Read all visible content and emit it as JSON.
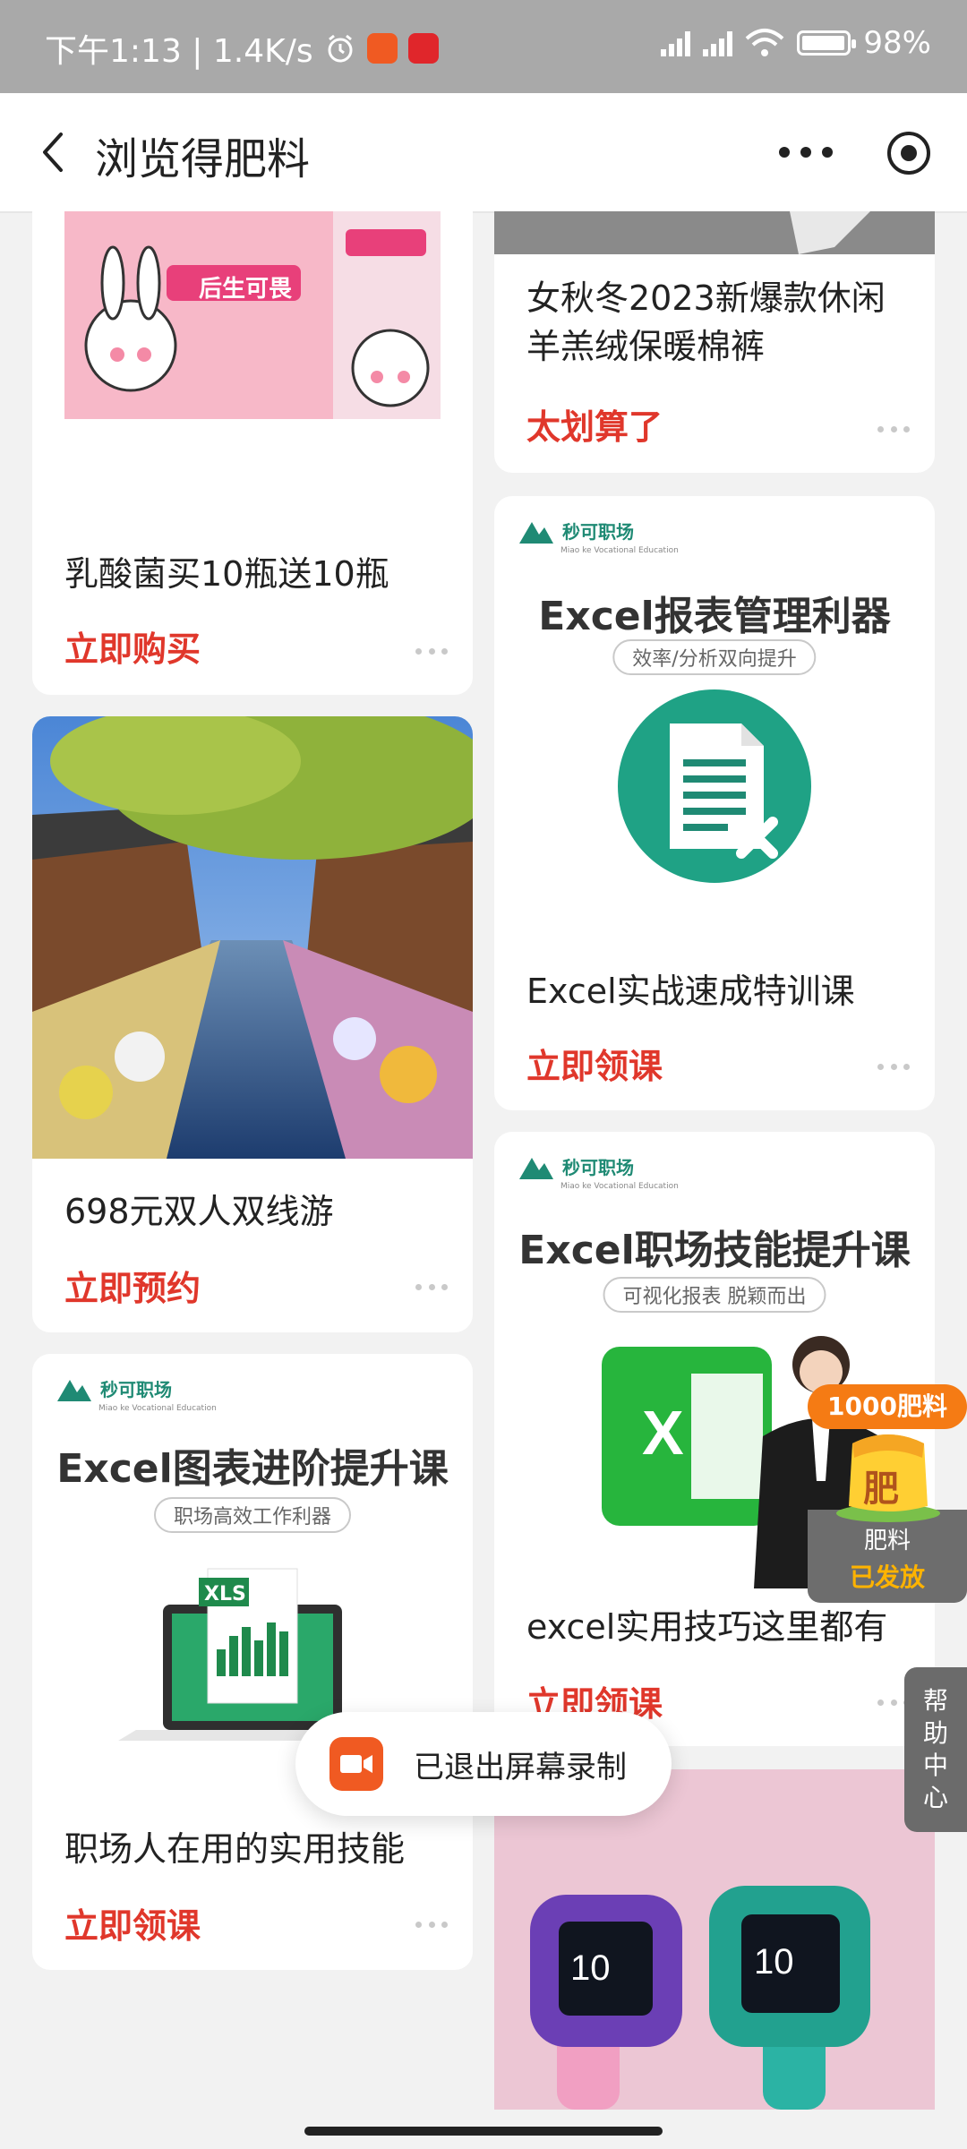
{
  "status_bar": {
    "time_speed": "下午1:13 | 1.4K/s",
    "battery": "98%",
    "battery_level": 0.98,
    "icons": [
      "alarm-icon",
      "screen-record-app-icon",
      "news-app-icon",
      "signal-hd-1-icon",
      "signal-hd-2-icon",
      "wifi-icon",
      "battery-icon"
    ]
  },
  "header": {
    "title": "浏览得肥料",
    "back_icon": "chevron-left-icon",
    "more_icon": "more-dots-icon",
    "target_icon": "target-icon"
  },
  "cards": {
    "yogurt": {
      "image_text": "后生可畏",
      "name": "乳酸菌买10瓶送10瓶",
      "cta": "立即购买"
    },
    "pants": {
      "name": "女秋冬2023新爆款休闲羊羔绒保暖棉裤",
      "cta": "太划算了"
    },
    "excel_report": {
      "brand": "秒可职场",
      "brand_sub": "Miao ke Vocational Education",
      "promo_title": "Excel报表管理利器",
      "promo_pill": "效率/分析双向提升",
      "name": "Excel实战速成特训课",
      "cta": "立即领课"
    },
    "travel": {
      "name": "698元双人双线游",
      "cta": "立即预约"
    },
    "excel_skill": {
      "brand": "秒可职场",
      "brand_sub": "Miao ke Vocational Education",
      "promo_title": "Excel职场技能提升课",
      "promo_pill": "可视化报表 脱颖而出",
      "name": "excel实用技巧这里都有",
      "cta": "立即领课"
    },
    "excel_chart": {
      "brand": "秒可职场",
      "brand_sub": "Miao ke Vocational Education",
      "promo_title": "Excel图表进阶提升课",
      "promo_pill": "职场高效工作利器",
      "xls_label": "XLS",
      "name": "职场人在用的实用技能",
      "cta": "立即领课"
    },
    "watch": {}
  },
  "reward": {
    "amount": "1000肥料",
    "icon_char": "肥",
    "line1": "肥料",
    "line2": "已发放"
  },
  "toast": {
    "text": "已退出屏幕录制",
    "icon": "video-camera-icon"
  },
  "help_tab": {
    "label": "帮助中心"
  }
}
